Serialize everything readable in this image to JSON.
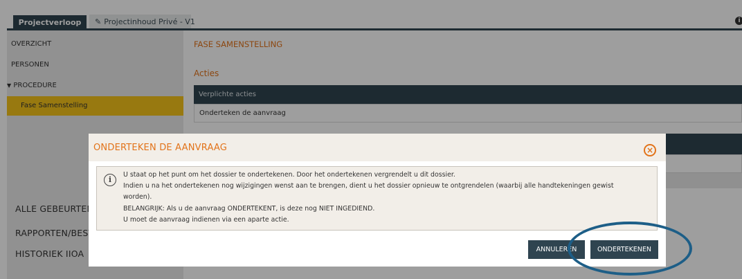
{
  "tabs": {
    "active_label": "Projectverloop",
    "inactive_label": "Projectinhoud Privé - V1",
    "inactive_icon": "pencil-icon"
  },
  "sidebar": {
    "items": [
      {
        "label": "OVERZICHT"
      },
      {
        "label": "PERSONEN"
      },
      {
        "label": "PROCEDURE",
        "expand_glyph": "▼"
      }
    ],
    "selected": "Fase Samenstelling",
    "big_items": [
      "ALLE GEBEURTENISSEN",
      "RAPPORTEN/BESTANDEN",
      "HISTORIEK IIOA"
    ]
  },
  "main": {
    "title": "FASE SAMENSTELLING",
    "acties": "Acties",
    "verplichte_header": "Verplichte acties",
    "verplichte_row": "Onderteken de aanvraag"
  },
  "modal": {
    "title": "ONDERTEKEN DE AANVRAAG",
    "close_glyph": "×",
    "info_glyph": "i",
    "lines": [
      "U staat op het punt om het dossier te ondertekenen. Door het ondertekenen vergrendelt u dit dossier.",
      "Indien u na het ondertekenen nog wijzigingen wenst aan te brengen, dient u het dossier opnieuw te ontgrendelen (waarbij alle handtekeningen gewist",
      "worden).",
      "BELANGRIJK: Als u de aanvraag ONDERTEKENT, is deze nog NIET INGEDIEND.",
      "U moet de aanvraag indienen via een aparte actie."
    ],
    "cancel_label": "ANNULEREN",
    "sign_label": "ONDERTEKENEN"
  },
  "colors": {
    "dark_blue": "#2f4450",
    "orange": "#e2731a",
    "highlight_yellow": "#f5c31a",
    "annotation_blue": "#1d5e87"
  }
}
